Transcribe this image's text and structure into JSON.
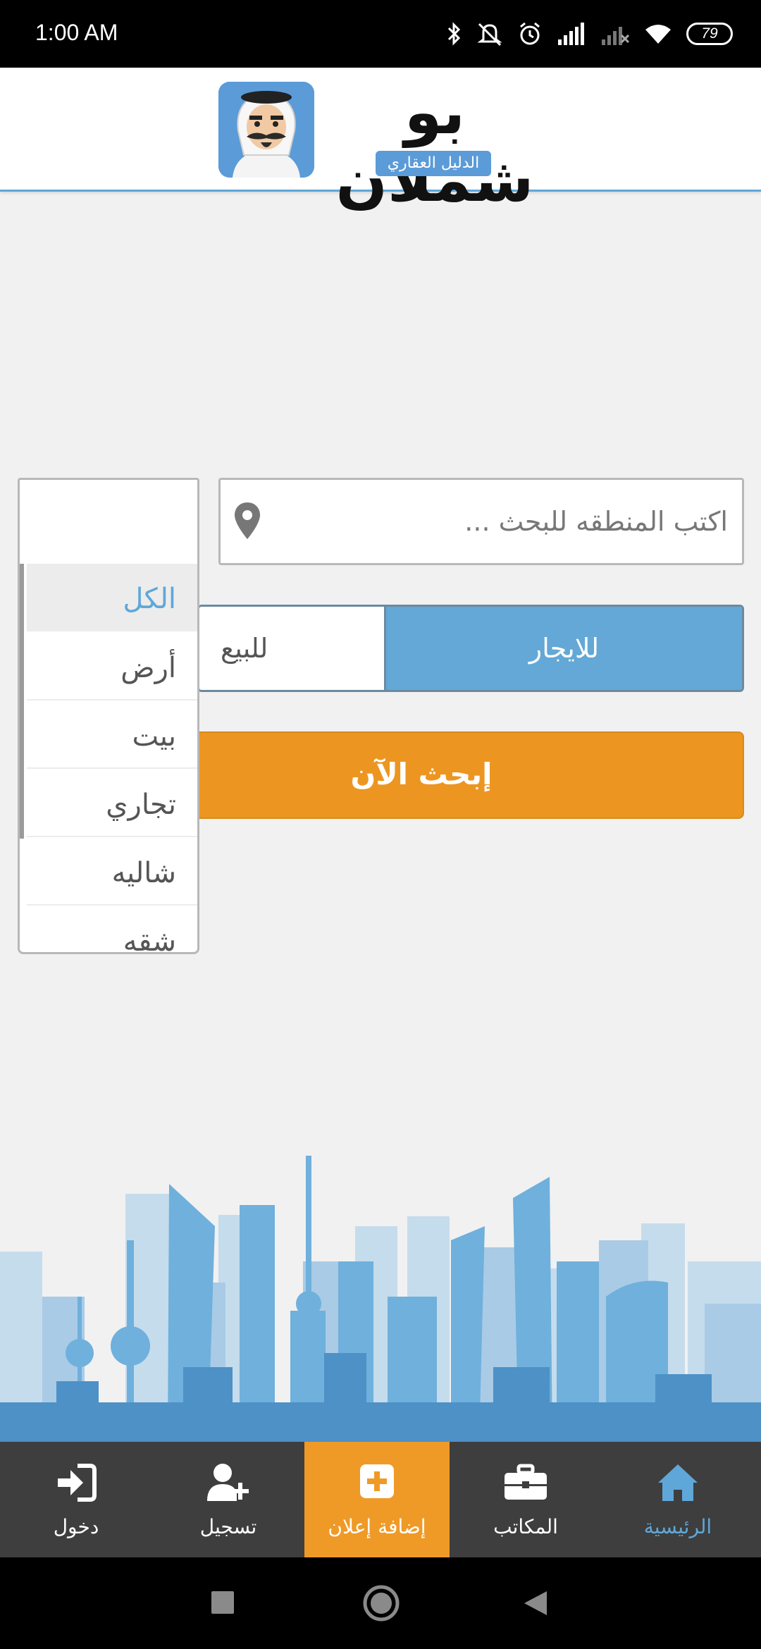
{
  "status_bar": {
    "time": "1:00 AM",
    "battery": "79",
    "icons": [
      "bluetooth-icon",
      "mute-icon",
      "alarm-icon",
      "signal-icon",
      "signal-no-service-icon",
      "wifi-icon"
    ]
  },
  "header": {
    "title": "بو شملان",
    "subtitle": "الدليل العقاري"
  },
  "search": {
    "placeholder": "اكتب المنطقه للبحث ...",
    "value": ""
  },
  "category_select": {
    "value": "",
    "options": [
      {
        "label": "الكل",
        "selected": true
      },
      {
        "label": "أرض",
        "selected": false
      },
      {
        "label": "بيت",
        "selected": false
      },
      {
        "label": "تجاري",
        "selected": false
      },
      {
        "label": "شاليه",
        "selected": false
      },
      {
        "label": "شقه",
        "selected": false
      }
    ]
  },
  "mode_toggle": {
    "rent_label": "للايجار",
    "sale_label": "للبيع",
    "active": "rent"
  },
  "search_button": {
    "label": "إبحث الآن"
  },
  "bottom_nav": {
    "items": [
      {
        "label": "دخول",
        "icon": "sign-in-icon"
      },
      {
        "label": "تسجيل",
        "icon": "user-plus-icon"
      },
      {
        "label": "إضافة إعلان",
        "icon": "plus-square-icon"
      },
      {
        "label": "المكاتب",
        "icon": "briefcase-icon"
      },
      {
        "label": "الرئيسية",
        "icon": "home-icon"
      }
    ],
    "active": "الرئيسية",
    "highlighted": "إضافة إعلان"
  },
  "colors": {
    "accent_blue": "#5fa7d8",
    "accent_orange": "#ec9621",
    "nav_background": "#3e3e3e"
  }
}
